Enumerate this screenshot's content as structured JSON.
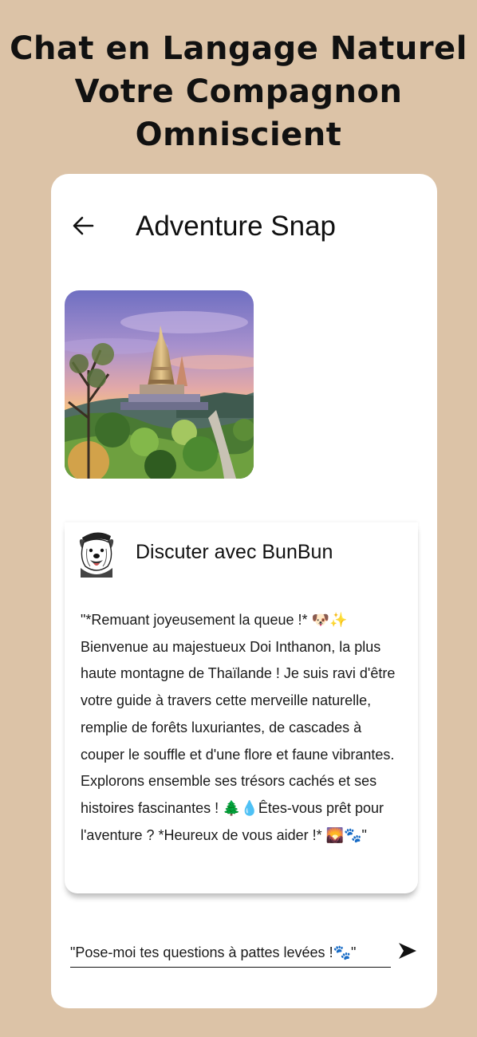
{
  "headline": {
    "line1": "Chat en Langage Naturel",
    "line2": "Votre Compagnon",
    "line3": "Omniscient"
  },
  "header": {
    "back_icon": "arrow-left-icon",
    "title": "Adventure Snap"
  },
  "hero": {
    "subject": "Doi Inthanon royal pagoda at sunset"
  },
  "chat": {
    "avatar_icon": "dog-avatar-icon",
    "title": "Discuter avec BunBun",
    "message": "\"*Remuant joyeusement la queue !* 🐶✨ Bienvenue au majestueux Doi Inthanon, la plus haute montagne de Thaïlande ! Je suis ravi d'être votre guide à travers cette merveille naturelle, remplie de forêts luxuriantes, de cascades à couper le souffle et d'une flore et faune vibrantes. Explorons ensemble ses trésors cachés et ses histoires fascinantes ! 🌲💧Êtes-vous prêt pour l'aventure ? *Heureux de vous aider !* 🌄🐾\""
  },
  "input": {
    "placeholder": "\"Pose-moi tes questions à pattes levées !🐾\"",
    "send_icon": "send-arrow-icon"
  },
  "colors": {
    "background": "#dcc3a7",
    "card": "#ffffff",
    "text": "#111111"
  }
}
